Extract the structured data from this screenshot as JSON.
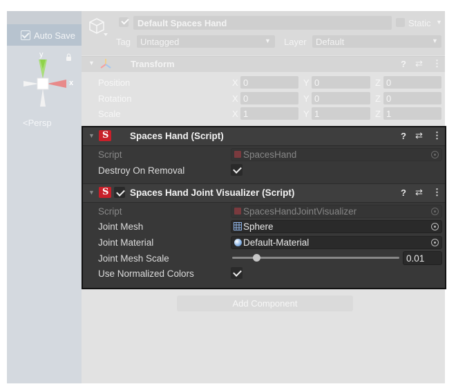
{
  "scene": {
    "auto_save_label": "Auto Save",
    "gizmo_y_label": "y",
    "gizmo_x_label": "x",
    "projection_label": "<Persp"
  },
  "object_header": {
    "name": "Default Spaces Hand",
    "static_label": "Static",
    "tag_label": "Tag",
    "tag_value": "Untagged",
    "layer_label": "Layer",
    "layer_value": "Default"
  },
  "transform": {
    "title": "Transform",
    "rows": [
      {
        "label": "Position",
        "x": "0",
        "y": "0",
        "z": "0"
      },
      {
        "label": "Rotation",
        "x": "0",
        "y": "0",
        "z": "0"
      },
      {
        "label": "Scale",
        "x": "1",
        "y": "1",
        "z": "1"
      }
    ],
    "axis_x": "X",
    "axis_y": "Y",
    "axis_z": "Z"
  },
  "spaces_hand": {
    "title": "Spaces Hand (Script)",
    "script_label": "Script",
    "script_value": "SpacesHand",
    "destroy_label": "Destroy On Removal",
    "destroy_checked": true
  },
  "visualizer": {
    "title": "Spaces Hand Joint Visualizer (Script)",
    "enabled": true,
    "script_label": "Script",
    "script_value": "SpacesHandJointVisualizer",
    "mesh_label": "Joint Mesh",
    "mesh_value": "Sphere",
    "material_label": "Joint Material",
    "material_value": "Default-Material",
    "scale_label": "Joint Mesh Scale",
    "scale_value": "0.01",
    "scale_fraction": 0.13,
    "normalized_label": "Use Normalized Colors",
    "normalized_checked": true
  },
  "add_component_label": "Add Component",
  "icons": {
    "help": "?",
    "presets": "⇄",
    "menu": "⋮",
    "logo": "S"
  },
  "colors": {
    "logo_red": "#c8202a",
    "gizmo_green": "#8fd34a",
    "gizmo_red": "#e05a5a"
  }
}
